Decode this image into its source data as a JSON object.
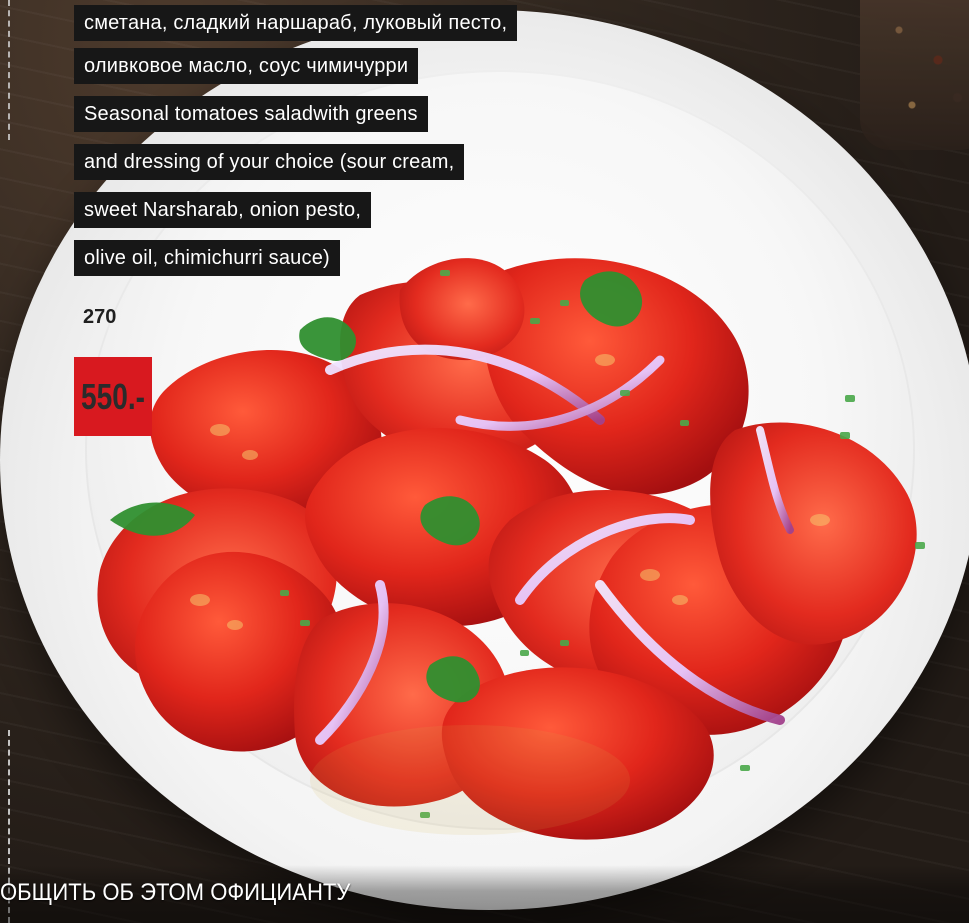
{
  "menu_item": {
    "description_lines": [
      "сметана, сладкий наршараб, луковый песто,",
      "оливковое масло, соус чимичурри",
      "Seasonal tomatoes saladwith greens",
      "and dressing of your choice (sour cream,",
      "sweet Narsharab, onion pesto,",
      "olive oil, chimichurri sauce)"
    ],
    "weight": "270",
    "price": "550.-"
  },
  "footer": {
    "notify_waiter": "ОБЩИТЬ ОБ ЭТОМ ОФИЦИАНТУ"
  },
  "colors": {
    "price_badge": "#d8191f",
    "text_bg": "#171717"
  },
  "icons": {
    "food_image": "tomato-salad-photo"
  }
}
